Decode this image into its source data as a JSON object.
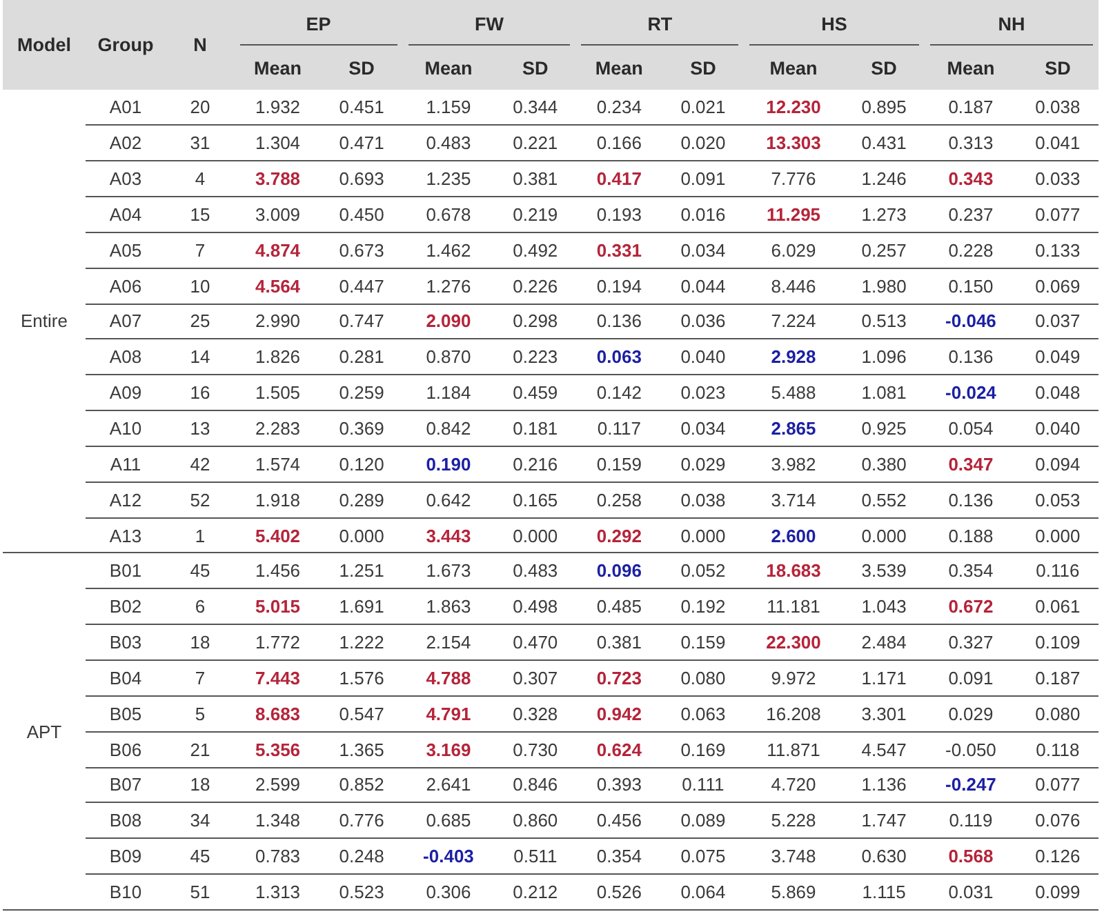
{
  "table": {
    "columns": {
      "model": "Model",
      "group": "Group",
      "n": "N",
      "measures": [
        {
          "name": "EP",
          "stats": [
            "Mean",
            "SD"
          ]
        },
        {
          "name": "FW",
          "stats": [
            "Mean",
            "SD"
          ]
        },
        {
          "name": "RT",
          "stats": [
            "Mean",
            "SD"
          ]
        },
        {
          "name": "HS",
          "stats": [
            "Mean",
            "SD"
          ]
        },
        {
          "name": "NH",
          "stats": [
            "Mean",
            "SD"
          ]
        }
      ]
    },
    "models": [
      {
        "name": "Entire",
        "rows": [
          {
            "group": "A01",
            "n": "20",
            "cells": [
              {
                "text": "1.932",
                "kind": "plain"
              },
              {
                "text": "0.451",
                "kind": "plain"
              },
              {
                "text": "1.159",
                "kind": "plain"
              },
              {
                "text": "0.344",
                "kind": "plain"
              },
              {
                "text": "0.234",
                "kind": "plain"
              },
              {
                "text": "0.021",
                "kind": "plain"
              },
              {
                "text": "12.230",
                "kind": "high"
              },
              {
                "text": "0.895",
                "kind": "plain"
              },
              {
                "text": "0.187",
                "kind": "plain"
              },
              {
                "text": "0.038",
                "kind": "plain"
              }
            ]
          },
          {
            "group": "A02",
            "n": "31",
            "cells": [
              {
                "text": "1.304",
                "kind": "plain"
              },
              {
                "text": "0.471",
                "kind": "plain"
              },
              {
                "text": "0.483",
                "kind": "plain"
              },
              {
                "text": "0.221",
                "kind": "plain"
              },
              {
                "text": "0.166",
                "kind": "plain"
              },
              {
                "text": "0.020",
                "kind": "plain"
              },
              {
                "text": "13.303",
                "kind": "high"
              },
              {
                "text": "0.431",
                "kind": "plain"
              },
              {
                "text": "0.313",
                "kind": "plain"
              },
              {
                "text": "0.041",
                "kind": "plain"
              }
            ]
          },
          {
            "group": "A03",
            "n": "4",
            "cells": [
              {
                "text": "3.788",
                "kind": "high"
              },
              {
                "text": "0.693",
                "kind": "plain"
              },
              {
                "text": "1.235",
                "kind": "plain"
              },
              {
                "text": "0.381",
                "kind": "plain"
              },
              {
                "text": "0.417",
                "kind": "high"
              },
              {
                "text": "0.091",
                "kind": "plain"
              },
              {
                "text": "7.776",
                "kind": "plain"
              },
              {
                "text": "1.246",
                "kind": "plain"
              },
              {
                "text": "0.343",
                "kind": "high"
              },
              {
                "text": "0.033",
                "kind": "plain"
              }
            ]
          },
          {
            "group": "A04",
            "n": "15",
            "cells": [
              {
                "text": "3.009",
                "kind": "plain"
              },
              {
                "text": "0.450",
                "kind": "plain"
              },
              {
                "text": "0.678",
                "kind": "plain"
              },
              {
                "text": "0.219",
                "kind": "plain"
              },
              {
                "text": "0.193",
                "kind": "plain"
              },
              {
                "text": "0.016",
                "kind": "plain"
              },
              {
                "text": "11.295",
                "kind": "high"
              },
              {
                "text": "1.273",
                "kind": "plain"
              },
              {
                "text": "0.237",
                "kind": "plain"
              },
              {
                "text": "0.077",
                "kind": "plain"
              }
            ]
          },
          {
            "group": "A05",
            "n": "7",
            "cells": [
              {
                "text": "4.874",
                "kind": "high"
              },
              {
                "text": "0.673",
                "kind": "plain"
              },
              {
                "text": "1.462",
                "kind": "plain"
              },
              {
                "text": "0.492",
                "kind": "plain"
              },
              {
                "text": "0.331",
                "kind": "high"
              },
              {
                "text": "0.034",
                "kind": "plain"
              },
              {
                "text": "6.029",
                "kind": "plain"
              },
              {
                "text": "0.257",
                "kind": "plain"
              },
              {
                "text": "0.228",
                "kind": "plain"
              },
              {
                "text": "0.133",
                "kind": "plain"
              }
            ]
          },
          {
            "group": "A06",
            "n": "10",
            "cells": [
              {
                "text": "4.564",
                "kind": "high"
              },
              {
                "text": "0.447",
                "kind": "plain"
              },
              {
                "text": "1.276",
                "kind": "plain"
              },
              {
                "text": "0.226",
                "kind": "plain"
              },
              {
                "text": "0.194",
                "kind": "plain"
              },
              {
                "text": "0.044",
                "kind": "plain"
              },
              {
                "text": "8.446",
                "kind": "plain"
              },
              {
                "text": "1.980",
                "kind": "plain"
              },
              {
                "text": "0.150",
                "kind": "plain"
              },
              {
                "text": "0.069",
                "kind": "plain"
              }
            ]
          },
          {
            "group": "A07",
            "n": "25",
            "cells": [
              {
                "text": "2.990",
                "kind": "plain"
              },
              {
                "text": "0.747",
                "kind": "plain"
              },
              {
                "text": "2.090",
                "kind": "high"
              },
              {
                "text": "0.298",
                "kind": "plain"
              },
              {
                "text": "0.136",
                "kind": "plain"
              },
              {
                "text": "0.036",
                "kind": "plain"
              },
              {
                "text": "7.224",
                "kind": "plain"
              },
              {
                "text": "0.513",
                "kind": "plain"
              },
              {
                "text": "-0.046",
                "kind": "low"
              },
              {
                "text": "0.037",
                "kind": "plain"
              }
            ]
          },
          {
            "group": "A08",
            "n": "14",
            "cells": [
              {
                "text": "1.826",
                "kind": "plain"
              },
              {
                "text": "0.281",
                "kind": "plain"
              },
              {
                "text": "0.870",
                "kind": "plain"
              },
              {
                "text": "0.223",
                "kind": "plain"
              },
              {
                "text": "0.063",
                "kind": "low"
              },
              {
                "text": "0.040",
                "kind": "plain"
              },
              {
                "text": "2.928",
                "kind": "low"
              },
              {
                "text": "1.096",
                "kind": "plain"
              },
              {
                "text": "0.136",
                "kind": "plain"
              },
              {
                "text": "0.049",
                "kind": "plain"
              }
            ]
          },
          {
            "group": "A09",
            "n": "16",
            "cells": [
              {
                "text": "1.505",
                "kind": "plain"
              },
              {
                "text": "0.259",
                "kind": "plain"
              },
              {
                "text": "1.184",
                "kind": "plain"
              },
              {
                "text": "0.459",
                "kind": "plain"
              },
              {
                "text": "0.142",
                "kind": "plain"
              },
              {
                "text": "0.023",
                "kind": "plain"
              },
              {
                "text": "5.488",
                "kind": "plain"
              },
              {
                "text": "1.081",
                "kind": "plain"
              },
              {
                "text": "-0.024",
                "kind": "low"
              },
              {
                "text": "0.048",
                "kind": "plain"
              }
            ]
          },
          {
            "group": "A10",
            "n": "13",
            "cells": [
              {
                "text": "2.283",
                "kind": "plain"
              },
              {
                "text": "0.369",
                "kind": "plain"
              },
              {
                "text": "0.842",
                "kind": "plain"
              },
              {
                "text": "0.181",
                "kind": "plain"
              },
              {
                "text": "0.117",
                "kind": "plain"
              },
              {
                "text": "0.034",
                "kind": "plain"
              },
              {
                "text": "2.865",
                "kind": "low"
              },
              {
                "text": "0.925",
                "kind": "plain"
              },
              {
                "text": "0.054",
                "kind": "plain"
              },
              {
                "text": "0.040",
                "kind": "plain"
              }
            ]
          },
          {
            "group": "A11",
            "n": "42",
            "cells": [
              {
                "text": "1.574",
                "kind": "plain"
              },
              {
                "text": "0.120",
                "kind": "plain"
              },
              {
                "text": "0.190",
                "kind": "low"
              },
              {
                "text": "0.216",
                "kind": "plain"
              },
              {
                "text": "0.159",
                "kind": "plain"
              },
              {
                "text": "0.029",
                "kind": "plain"
              },
              {
                "text": "3.982",
                "kind": "plain"
              },
              {
                "text": "0.380",
                "kind": "plain"
              },
              {
                "text": "0.347",
                "kind": "high"
              },
              {
                "text": "0.094",
                "kind": "plain"
              }
            ]
          },
          {
            "group": "A12",
            "n": "52",
            "cells": [
              {
                "text": "1.918",
                "kind": "plain"
              },
              {
                "text": "0.289",
                "kind": "plain"
              },
              {
                "text": "0.642",
                "kind": "plain"
              },
              {
                "text": "0.165",
                "kind": "plain"
              },
              {
                "text": "0.258",
                "kind": "plain"
              },
              {
                "text": "0.038",
                "kind": "plain"
              },
              {
                "text": "3.714",
                "kind": "plain"
              },
              {
                "text": "0.552",
                "kind": "plain"
              },
              {
                "text": "0.136",
                "kind": "plain"
              },
              {
                "text": "0.053",
                "kind": "plain"
              }
            ]
          },
          {
            "group": "A13",
            "n": "1",
            "cells": [
              {
                "text": "5.402",
                "kind": "high"
              },
              {
                "text": "0.000",
                "kind": "plain"
              },
              {
                "text": "3.443",
                "kind": "high"
              },
              {
                "text": "0.000",
                "kind": "plain"
              },
              {
                "text": "0.292",
                "kind": "high"
              },
              {
                "text": "0.000",
                "kind": "plain"
              },
              {
                "text": "2.600",
                "kind": "low"
              },
              {
                "text": "0.000",
                "kind": "plain"
              },
              {
                "text": "0.188",
                "kind": "plain"
              },
              {
                "text": "0.000",
                "kind": "plain"
              }
            ]
          }
        ]
      },
      {
        "name": "APT",
        "rows": [
          {
            "group": "B01",
            "n": "45",
            "cells": [
              {
                "text": "1.456",
                "kind": "plain"
              },
              {
                "text": "1.251",
                "kind": "plain"
              },
              {
                "text": "1.673",
                "kind": "plain"
              },
              {
                "text": "0.483",
                "kind": "plain"
              },
              {
                "text": "0.096",
                "kind": "low"
              },
              {
                "text": "0.052",
                "kind": "plain"
              },
              {
                "text": "18.683",
                "kind": "high"
              },
              {
                "text": "3.539",
                "kind": "plain"
              },
              {
                "text": "0.354",
                "kind": "plain"
              },
              {
                "text": "0.116",
                "kind": "plain"
              }
            ]
          },
          {
            "group": "B02",
            "n": "6",
            "cells": [
              {
                "text": "5.015",
                "kind": "high"
              },
              {
                "text": "1.691",
                "kind": "plain"
              },
              {
                "text": "1.863",
                "kind": "plain"
              },
              {
                "text": "0.498",
                "kind": "plain"
              },
              {
                "text": "0.485",
                "kind": "plain"
              },
              {
                "text": "0.192",
                "kind": "plain"
              },
              {
                "text": "11.181",
                "kind": "plain"
              },
              {
                "text": "1.043",
                "kind": "plain"
              },
              {
                "text": "0.672",
                "kind": "high"
              },
              {
                "text": "0.061",
                "kind": "plain"
              }
            ]
          },
          {
            "group": "B03",
            "n": "18",
            "cells": [
              {
                "text": "1.772",
                "kind": "plain"
              },
              {
                "text": "1.222",
                "kind": "plain"
              },
              {
                "text": "2.154",
                "kind": "plain"
              },
              {
                "text": "0.470",
                "kind": "plain"
              },
              {
                "text": "0.381",
                "kind": "plain"
              },
              {
                "text": "0.159",
                "kind": "plain"
              },
              {
                "text": "22.300",
                "kind": "high"
              },
              {
                "text": "2.484",
                "kind": "plain"
              },
              {
                "text": "0.327",
                "kind": "plain"
              },
              {
                "text": "0.109",
                "kind": "plain"
              }
            ]
          },
          {
            "group": "B04",
            "n": "7",
            "cells": [
              {
                "text": "7.443",
                "kind": "high"
              },
              {
                "text": "1.576",
                "kind": "plain"
              },
              {
                "text": "4.788",
                "kind": "high"
              },
              {
                "text": "0.307",
                "kind": "plain"
              },
              {
                "text": "0.723",
                "kind": "high"
              },
              {
                "text": "0.080",
                "kind": "plain"
              },
              {
                "text": "9.972",
                "kind": "plain"
              },
              {
                "text": "1.171",
                "kind": "plain"
              },
              {
                "text": "0.091",
                "kind": "plain"
              },
              {
                "text": "0.187",
                "kind": "plain"
              }
            ]
          },
          {
            "group": "B05",
            "n": "5",
            "cells": [
              {
                "text": "8.683",
                "kind": "high"
              },
              {
                "text": "0.547",
                "kind": "plain"
              },
              {
                "text": "4.791",
                "kind": "high"
              },
              {
                "text": "0.328",
                "kind": "plain"
              },
              {
                "text": "0.942",
                "kind": "high"
              },
              {
                "text": "0.063",
                "kind": "plain"
              },
              {
                "text": "16.208",
                "kind": "plain"
              },
              {
                "text": "3.301",
                "kind": "plain"
              },
              {
                "text": "0.029",
                "kind": "plain"
              },
              {
                "text": "0.080",
                "kind": "plain"
              }
            ]
          },
          {
            "group": "B06",
            "n": "21",
            "cells": [
              {
                "text": "5.356",
                "kind": "high"
              },
              {
                "text": "1.365",
                "kind": "plain"
              },
              {
                "text": "3.169",
                "kind": "high"
              },
              {
                "text": "0.730",
                "kind": "plain"
              },
              {
                "text": "0.624",
                "kind": "high"
              },
              {
                "text": "0.169",
                "kind": "plain"
              },
              {
                "text": "11.871",
                "kind": "plain"
              },
              {
                "text": "4.547",
                "kind": "plain"
              },
              {
                "text": "-0.050",
                "kind": "plain"
              },
              {
                "text": "0.118",
                "kind": "plain"
              }
            ]
          },
          {
            "group": "B07",
            "n": "18",
            "cells": [
              {
                "text": "2.599",
                "kind": "plain"
              },
              {
                "text": "0.852",
                "kind": "plain"
              },
              {
                "text": "2.641",
                "kind": "plain"
              },
              {
                "text": "0.846",
                "kind": "plain"
              },
              {
                "text": "0.393",
                "kind": "plain"
              },
              {
                "text": "0.111",
                "kind": "plain"
              },
              {
                "text": "4.720",
                "kind": "plain"
              },
              {
                "text": "1.136",
                "kind": "plain"
              },
              {
                "text": "-0.247",
                "kind": "low"
              },
              {
                "text": "0.077",
                "kind": "plain"
              }
            ]
          },
          {
            "group": "B08",
            "n": "34",
            "cells": [
              {
                "text": "1.348",
                "kind": "plain"
              },
              {
                "text": "0.776",
                "kind": "plain"
              },
              {
                "text": "0.685",
                "kind": "plain"
              },
              {
                "text": "0.860",
                "kind": "plain"
              },
              {
                "text": "0.456",
                "kind": "plain"
              },
              {
                "text": "0.089",
                "kind": "plain"
              },
              {
                "text": "5.228",
                "kind": "plain"
              },
              {
                "text": "1.747",
                "kind": "plain"
              },
              {
                "text": "0.119",
                "kind": "plain"
              },
              {
                "text": "0.076",
                "kind": "plain"
              }
            ]
          },
          {
            "group": "B09",
            "n": "45",
            "cells": [
              {
                "text": "0.783",
                "kind": "plain"
              },
              {
                "text": "0.248",
                "kind": "plain"
              },
              {
                "text": "-0.403",
                "kind": "low"
              },
              {
                "text": "0.511",
                "kind": "plain"
              },
              {
                "text": "0.354",
                "kind": "plain"
              },
              {
                "text": "0.075",
                "kind": "plain"
              },
              {
                "text": "3.748",
                "kind": "plain"
              },
              {
                "text": "0.630",
                "kind": "plain"
              },
              {
                "text": "0.568",
                "kind": "high"
              },
              {
                "text": "0.126",
                "kind": "plain"
              }
            ]
          },
          {
            "group": "B10",
            "n": "51",
            "cells": [
              {
                "text": "1.313",
                "kind": "plain"
              },
              {
                "text": "0.523",
                "kind": "plain"
              },
              {
                "text": "0.306",
                "kind": "plain"
              },
              {
                "text": "0.212",
                "kind": "plain"
              },
              {
                "text": "0.526",
                "kind": "plain"
              },
              {
                "text": "0.064",
                "kind": "plain"
              },
              {
                "text": "5.869",
                "kind": "plain"
              },
              {
                "text": "1.115",
                "kind": "plain"
              },
              {
                "text": "0.031",
                "kind": "plain"
              },
              {
                "text": "0.099",
                "kind": "plain"
              }
            ]
          }
        ]
      }
    ]
  }
}
